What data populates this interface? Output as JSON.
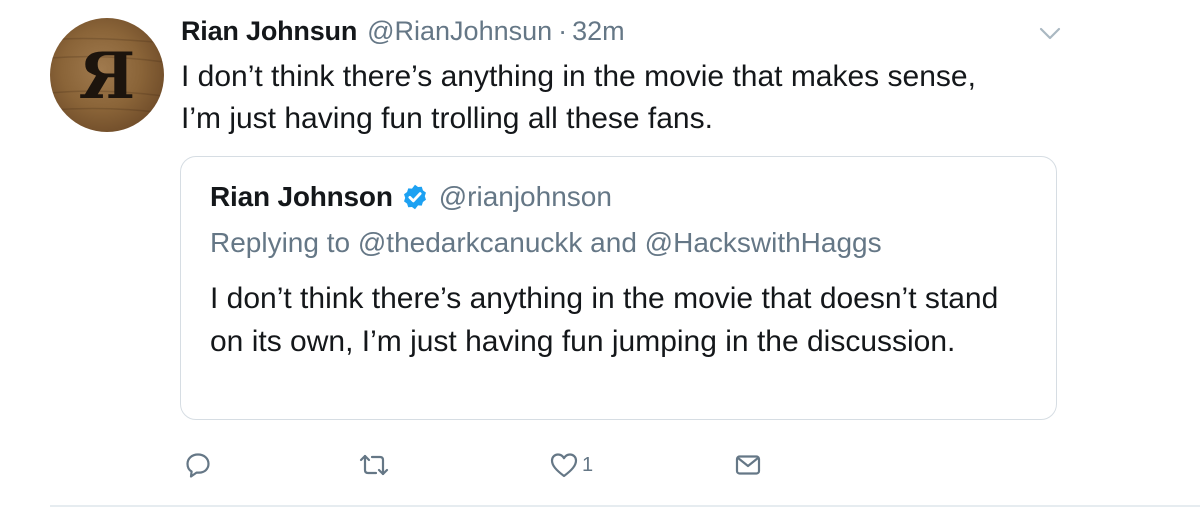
{
  "tweet": {
    "author": {
      "display_name": "Rian Johnsun",
      "handle": "@RianJohnsun",
      "avatar_text": "Я"
    },
    "separator": "·",
    "timestamp": "32m",
    "text": "I don’t think there’s anything in the movie that makes sense, I’m just having fun trolling all these fans.",
    "caret_icon": "chevron-down-icon",
    "quoted": {
      "author": {
        "display_name": "Rian Johnson",
        "verified": true,
        "handle": "@rianjohnson"
      },
      "replying_to": "Replying to @thedarkcanuckk and @HackswithHaggs",
      "text": "I don’t think there’s anything in the movie that doesn’t stand on its own, I’m just having fun jumping in the discussion."
    },
    "actions": {
      "reply_icon": "reply-icon",
      "retweet_icon": "retweet-icon",
      "like_icon": "heart-icon",
      "like_count": "1",
      "dm_icon": "envelope-icon"
    },
    "colors": {
      "text": "#14171a",
      "secondary": "#657786",
      "verified_blue": "#1da1f2",
      "border": "#d6dde3"
    }
  }
}
